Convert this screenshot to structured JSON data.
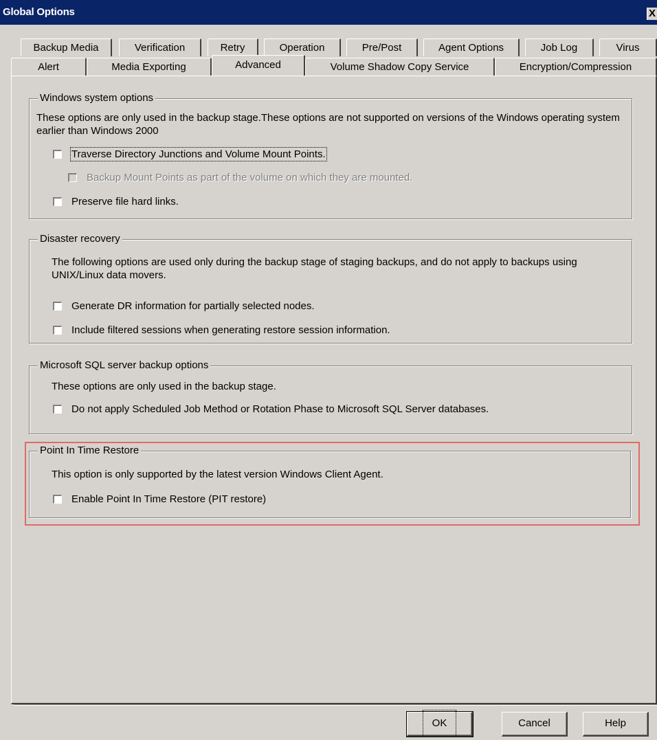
{
  "window": {
    "title": "Global Options",
    "close_glyph": "X"
  },
  "tabs_row1": [
    "Backup Media",
    "Verification",
    "Retry",
    "Operation",
    "Pre/Post",
    "Agent Options",
    "Job Log",
    "Virus"
  ],
  "tabs_row2": [
    "Alert",
    "Media Exporting",
    "Advanced",
    "Volume Shadow Copy Service",
    "Encryption/Compression"
  ],
  "active_tab": "Advanced",
  "windows_group": {
    "legend": "Windows system options",
    "description": "These options are only used in the backup stage.These options are not supported on versions of the Windows operating system earlier than Windows 2000",
    "options": [
      {
        "label": "Traverse Directory Junctions and Volume Mount Points.",
        "checked": false,
        "enabled": true
      },
      {
        "label": "Backup Mount Points as part of the volume on which they are mounted.",
        "checked": false,
        "enabled": false
      },
      {
        "label": "Preserve file hard links.",
        "checked": false,
        "enabled": true
      }
    ]
  },
  "dr_group": {
    "legend": "Disaster recovery",
    "description": "The following options are used only during the backup stage of staging backups, and do not apply to backups using UNIX/Linux data movers.",
    "options": [
      {
        "label": "Generate DR information for partially selected nodes.",
        "checked": false,
        "enabled": true
      },
      {
        "label": "Include filtered sessions when generating restore session information.",
        "checked": false,
        "enabled": true
      }
    ]
  },
  "sql_group": {
    "legend": "Microsoft SQL server backup options",
    "description": "These options are only used in the backup stage.",
    "options": [
      {
        "label": "Do not apply Scheduled Job Method or Rotation Phase to Microsoft SQL Server databases.",
        "checked": false,
        "enabled": true
      }
    ]
  },
  "pit_group": {
    "legend": "Point In Time Restore",
    "description": "This option is only supported by the latest version Windows Client Agent.",
    "options": [
      {
        "label": "Enable Point In Time Restore (PIT restore)",
        "checked": false,
        "enabled": true
      }
    ]
  },
  "buttons": {
    "ok": "OK",
    "cancel": "Cancel",
    "help": "Help"
  },
  "colors": {
    "titlebar": "#0a2468",
    "dialog_bg": "#d6d3ce",
    "highlight_border": "#e06a6a"
  }
}
